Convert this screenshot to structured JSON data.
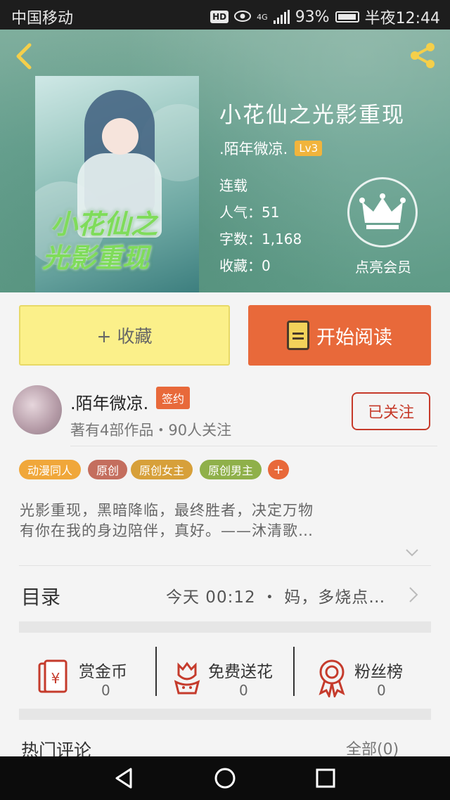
{
  "status_bar": {
    "carrier": "中国移动",
    "hd": "HD",
    "network": "4G",
    "battery": "93%",
    "time": "半夜12:44"
  },
  "book": {
    "title": "小花仙之光影重现",
    "author": ".陌年微凉.",
    "level": "Lv3",
    "status": "连载",
    "popularity": "人气：51",
    "word_count": "字数：1,168",
    "favorites": "收藏：0",
    "vip_label": "点亮会员",
    "cover_title_line1": "小花仙之",
    "cover_title_line2": "光影重现"
  },
  "actions": {
    "favorite": "+ 收藏",
    "read": "开始阅读"
  },
  "author_card": {
    "name": ".陌年微凉.",
    "badge": "签约",
    "info": "著有4部作品・90人关注",
    "follow": "已关注"
  },
  "tags": [
    {
      "label": "动漫同人",
      "color": "#f0a73a"
    },
    {
      "label": "原创",
      "color": "#c46e5e"
    },
    {
      "label": "原创女主",
      "color": "#d7a03a"
    },
    {
      "label": "原创男主",
      "color": "#8fb04a"
    }
  ],
  "tag_add": "+",
  "description": {
    "line1": "光影重现，黑暗降临，最终胜者，决定万物",
    "line2": "有你在我的身边陪伴，真好。——沐清歌…"
  },
  "toc": {
    "label": "目录",
    "update": "今天 00:12 ・ 妈，多烧点…"
  },
  "stats": [
    {
      "label": "赏金币",
      "value": "0",
      "icon": "red-envelope-icon"
    },
    {
      "label": "免费送花",
      "value": "0",
      "icon": "flower-icon"
    },
    {
      "label": "粉丝榜",
      "value": "0",
      "icon": "medal-icon"
    }
  ],
  "comments": {
    "label": "热门评论",
    "all": "全部(0)"
  },
  "colors": {
    "accent": "#e8693a",
    "favorite_bg": "#fbf08a",
    "follow": "#c63a2a",
    "header": "#6aa392"
  }
}
